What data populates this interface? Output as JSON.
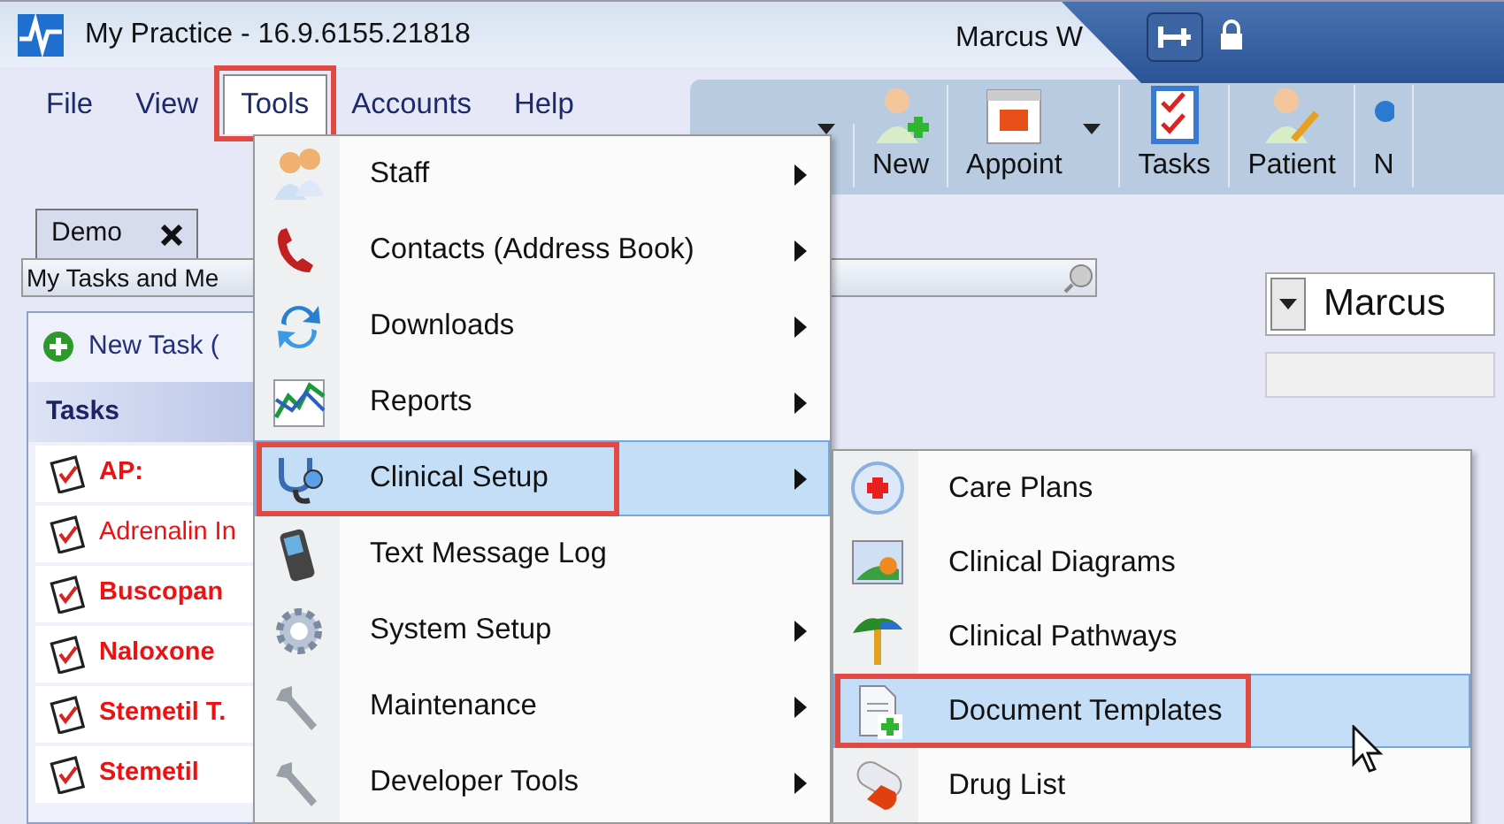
{
  "window": {
    "title": "My Practice - 16.9.6155.21818",
    "user": "Marcus W"
  },
  "menu_bar": [
    {
      "label": "File",
      "selected": false,
      "annotated": false
    },
    {
      "label": "View",
      "selected": false,
      "annotated": false
    },
    {
      "label": "Tools",
      "selected": true,
      "annotated": true
    },
    {
      "label": "Accounts",
      "selected": false,
      "annotated": false
    },
    {
      "label": "Help",
      "selected": false,
      "annotated": false
    }
  ],
  "toolbar": [
    {
      "has_dropdown": true
    },
    {
      "label": "New",
      "has_dropdown": false
    },
    {
      "label": "Appoint",
      "has_dropdown": true
    },
    {
      "label": "Tasks",
      "has_dropdown": false
    },
    {
      "label": "Patient",
      "has_dropdown": false
    },
    {
      "label": "N",
      "has_dropdown": false
    }
  ],
  "tabs": [
    {
      "label": "Demo",
      "selected": true
    }
  ],
  "panel": {
    "title": "My Tasks and Me",
    "new_task": "New Task (",
    "tasks_header": "Tasks",
    "tasks": [
      {
        "label": "AP:",
        "bold": true
      },
      {
        "label": "Adrenalin In",
        "bold": false
      },
      {
        "label": "Buscopan",
        "bold": true
      },
      {
        "label": "Naloxone",
        "bold": true
      },
      {
        "label": "Stemetil T.",
        "bold": true
      },
      {
        "label": "Stemetil",
        "bold": true
      }
    ]
  },
  "patient_selector": {
    "value": "Marcus"
  },
  "tools_menu": [
    {
      "label": "Staff",
      "has_submenu": true,
      "selected": false,
      "annotated": false
    },
    {
      "label": "Contacts (Address Book)",
      "has_submenu": true,
      "selected": false,
      "annotated": false
    },
    {
      "label": "Downloads",
      "has_submenu": true,
      "selected": false,
      "annotated": false
    },
    {
      "label": "Reports",
      "has_submenu": true,
      "selected": false,
      "annotated": false
    },
    {
      "label": "Clinical Setup",
      "has_submenu": true,
      "selected": true,
      "annotated": true
    },
    {
      "label": "Text Message Log",
      "has_submenu": false,
      "selected": false,
      "annotated": false
    },
    {
      "label": "System Setup",
      "has_submenu": true,
      "selected": false,
      "annotated": false
    },
    {
      "label": "Maintenance",
      "has_submenu": true,
      "selected": false,
      "annotated": false
    },
    {
      "label": "Developer Tools",
      "has_submenu": true,
      "selected": false,
      "annotated": false
    }
  ],
  "clinical_setup_menu": [
    {
      "label": "Care Plans",
      "selected": false,
      "annotated": false
    },
    {
      "label": "Clinical Diagrams",
      "selected": false,
      "annotated": false
    },
    {
      "label": "Clinical Pathways",
      "selected": false,
      "annotated": false
    },
    {
      "label": "Document Templates",
      "selected": true,
      "annotated": true
    },
    {
      "label": "Drug List",
      "selected": false,
      "annotated": false
    }
  ]
}
